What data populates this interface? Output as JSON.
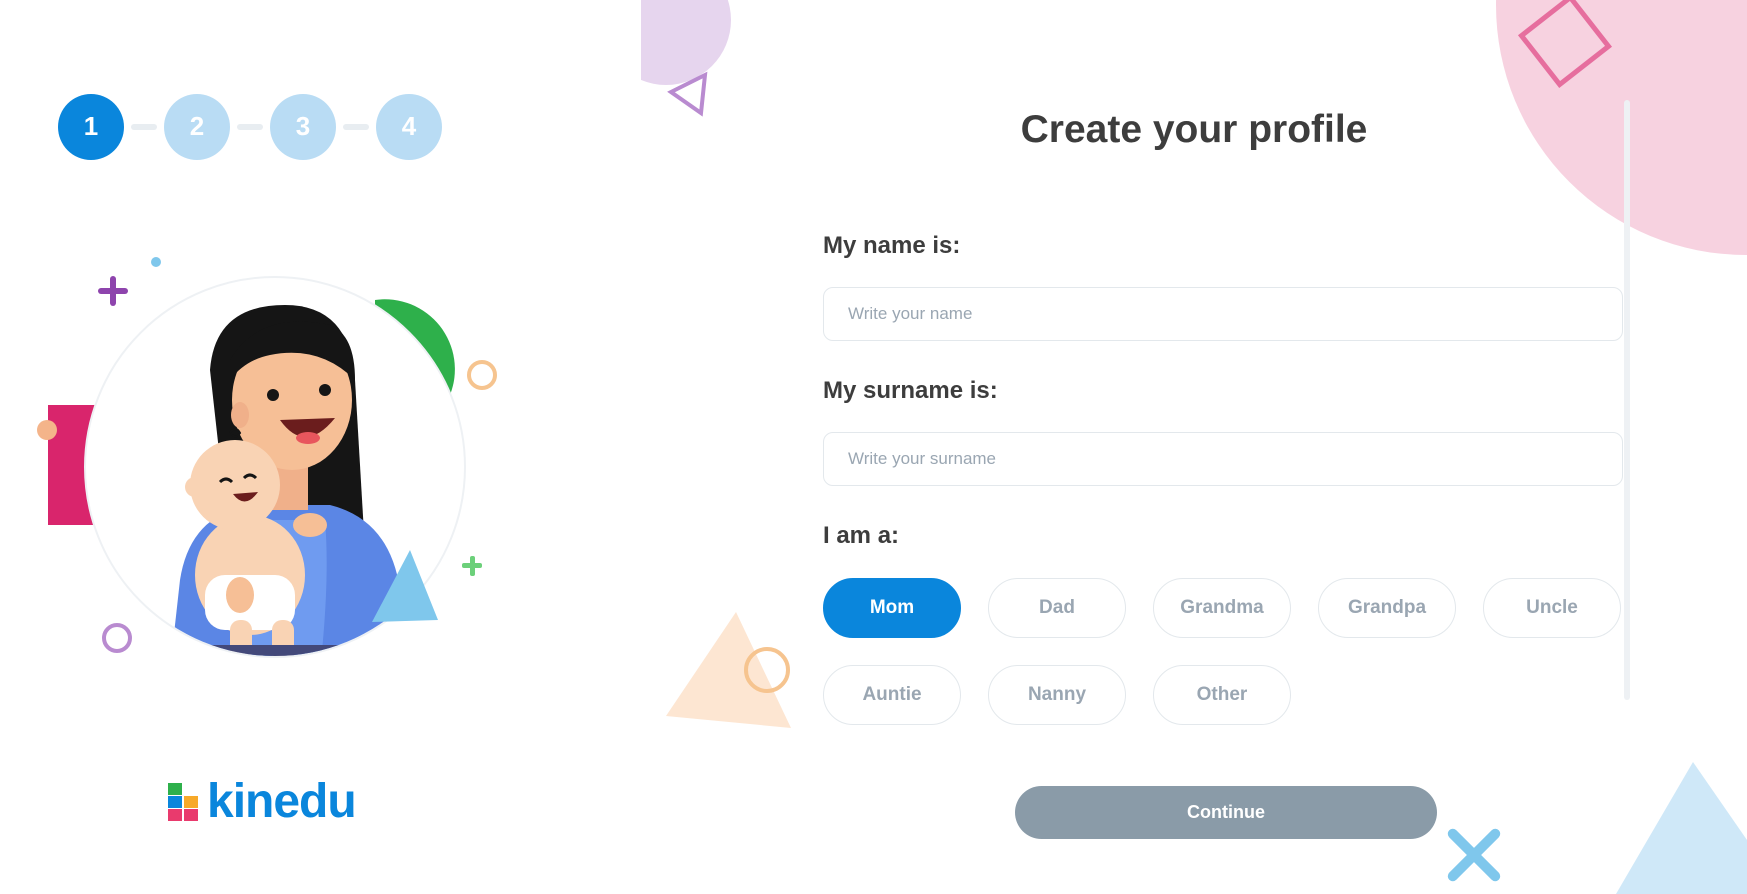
{
  "steps": [
    {
      "label": "1",
      "state": "active"
    },
    {
      "label": "2",
      "state": "inactive"
    },
    {
      "label": "3",
      "state": "inactive"
    },
    {
      "label": "4",
      "state": "inactive"
    }
  ],
  "brand": {
    "name": "kinedu",
    "color": "#0a86dc"
  },
  "title": "Create your profile",
  "form": {
    "name": {
      "label": "My name is:",
      "placeholder": "Write your name",
      "value": ""
    },
    "surname": {
      "label": "My surname is:",
      "placeholder": "Write your surname",
      "value": ""
    },
    "role": {
      "label": "I am a:",
      "selected": "Mom",
      "options": [
        "Mom",
        "Dad",
        "Grandma",
        "Grandpa",
        "Uncle",
        "Auntie",
        "Nanny",
        "Other"
      ]
    }
  },
  "continue_label": "Continue",
  "colors": {
    "accent": "#0a86dc",
    "step_inactive": "#b9dcf4",
    "button_disabled": "#8a9ba8",
    "heading": "#3d3d3d"
  }
}
